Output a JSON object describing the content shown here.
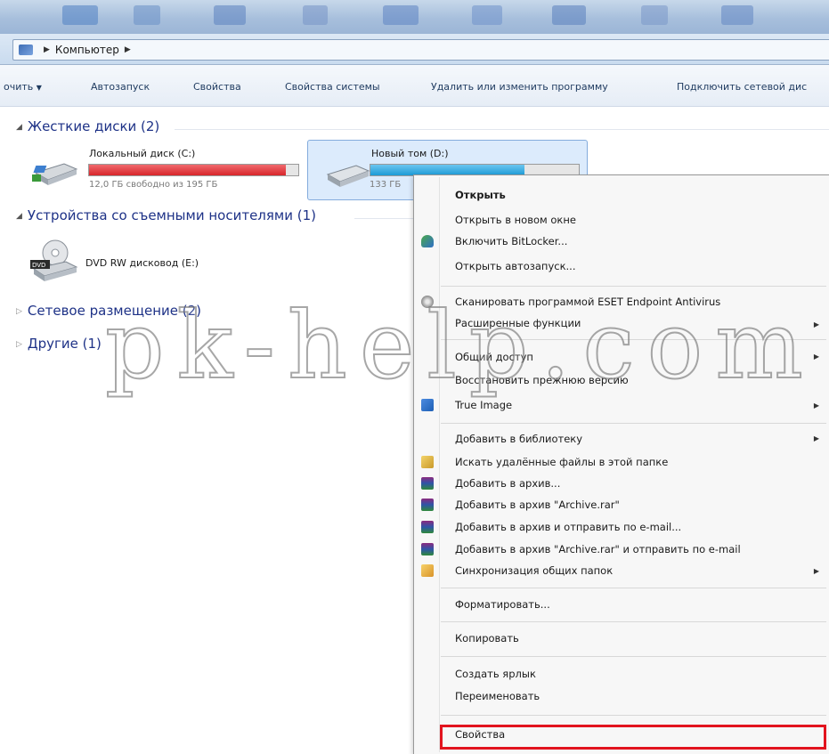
{
  "address": {
    "segments": [
      "Компьютер"
    ]
  },
  "toolbar": {
    "items": [
      "очить",
      "Автозапуск",
      "Свойства",
      "Свойства системы",
      "Удалить или изменить программу",
      "Подключить сетевой дис"
    ]
  },
  "groups": {
    "hard_disks": "Жесткие диски (2)",
    "removable": "Устройства со съемными носителями (1)",
    "network": "Сетевое размещение (2)",
    "other": "Другие (1)"
  },
  "drives": {
    "c": {
      "label": "Локальный диск (C:)",
      "free": "12,0 ГБ свободно из 195 ГБ",
      "used_fraction": 0.94
    },
    "d": {
      "label": "Новый том (D:)",
      "free": "133 ГБ",
      "used_fraction": 0.74
    },
    "e": {
      "label": "DVD RW дисковод (E:)",
      "badge": "DVD"
    }
  },
  "watermark": "pk-help.com",
  "context_menu": {
    "items": [
      "Открыть",
      "Открыть в новом окне",
      "Включить BitLocker...",
      "Открыть автозапуск...",
      "Сканировать программой ESET Endpoint Antivirus",
      "Расширенные функции",
      "Общий доступ",
      "Восстановить прежнюю версию",
      "True Image",
      "Добавить в библиотеку",
      "Искать удалённые файлы в этой папке",
      "Добавить в архив...",
      "Добавить в архив \"Archive.rar\"",
      "Добавить в архив и отправить по e-mail...",
      "Добавить в архив \"Archive.rar\" и отправить по e-mail",
      "Синхронизация общих папок",
      "Форматировать...",
      "Копировать",
      "Создать ярлык",
      "Переименовать",
      "Свойства"
    ],
    "icons": [
      "shield-icon",
      "eset-icon",
      "true-image-icon",
      "search-files-icon",
      "winrar-icon",
      "sync-icon"
    ]
  },
  "colors": {
    "c_bar": "#d8262b",
    "d_bar": "#1c9ad6",
    "highlight": "#e2141e"
  }
}
